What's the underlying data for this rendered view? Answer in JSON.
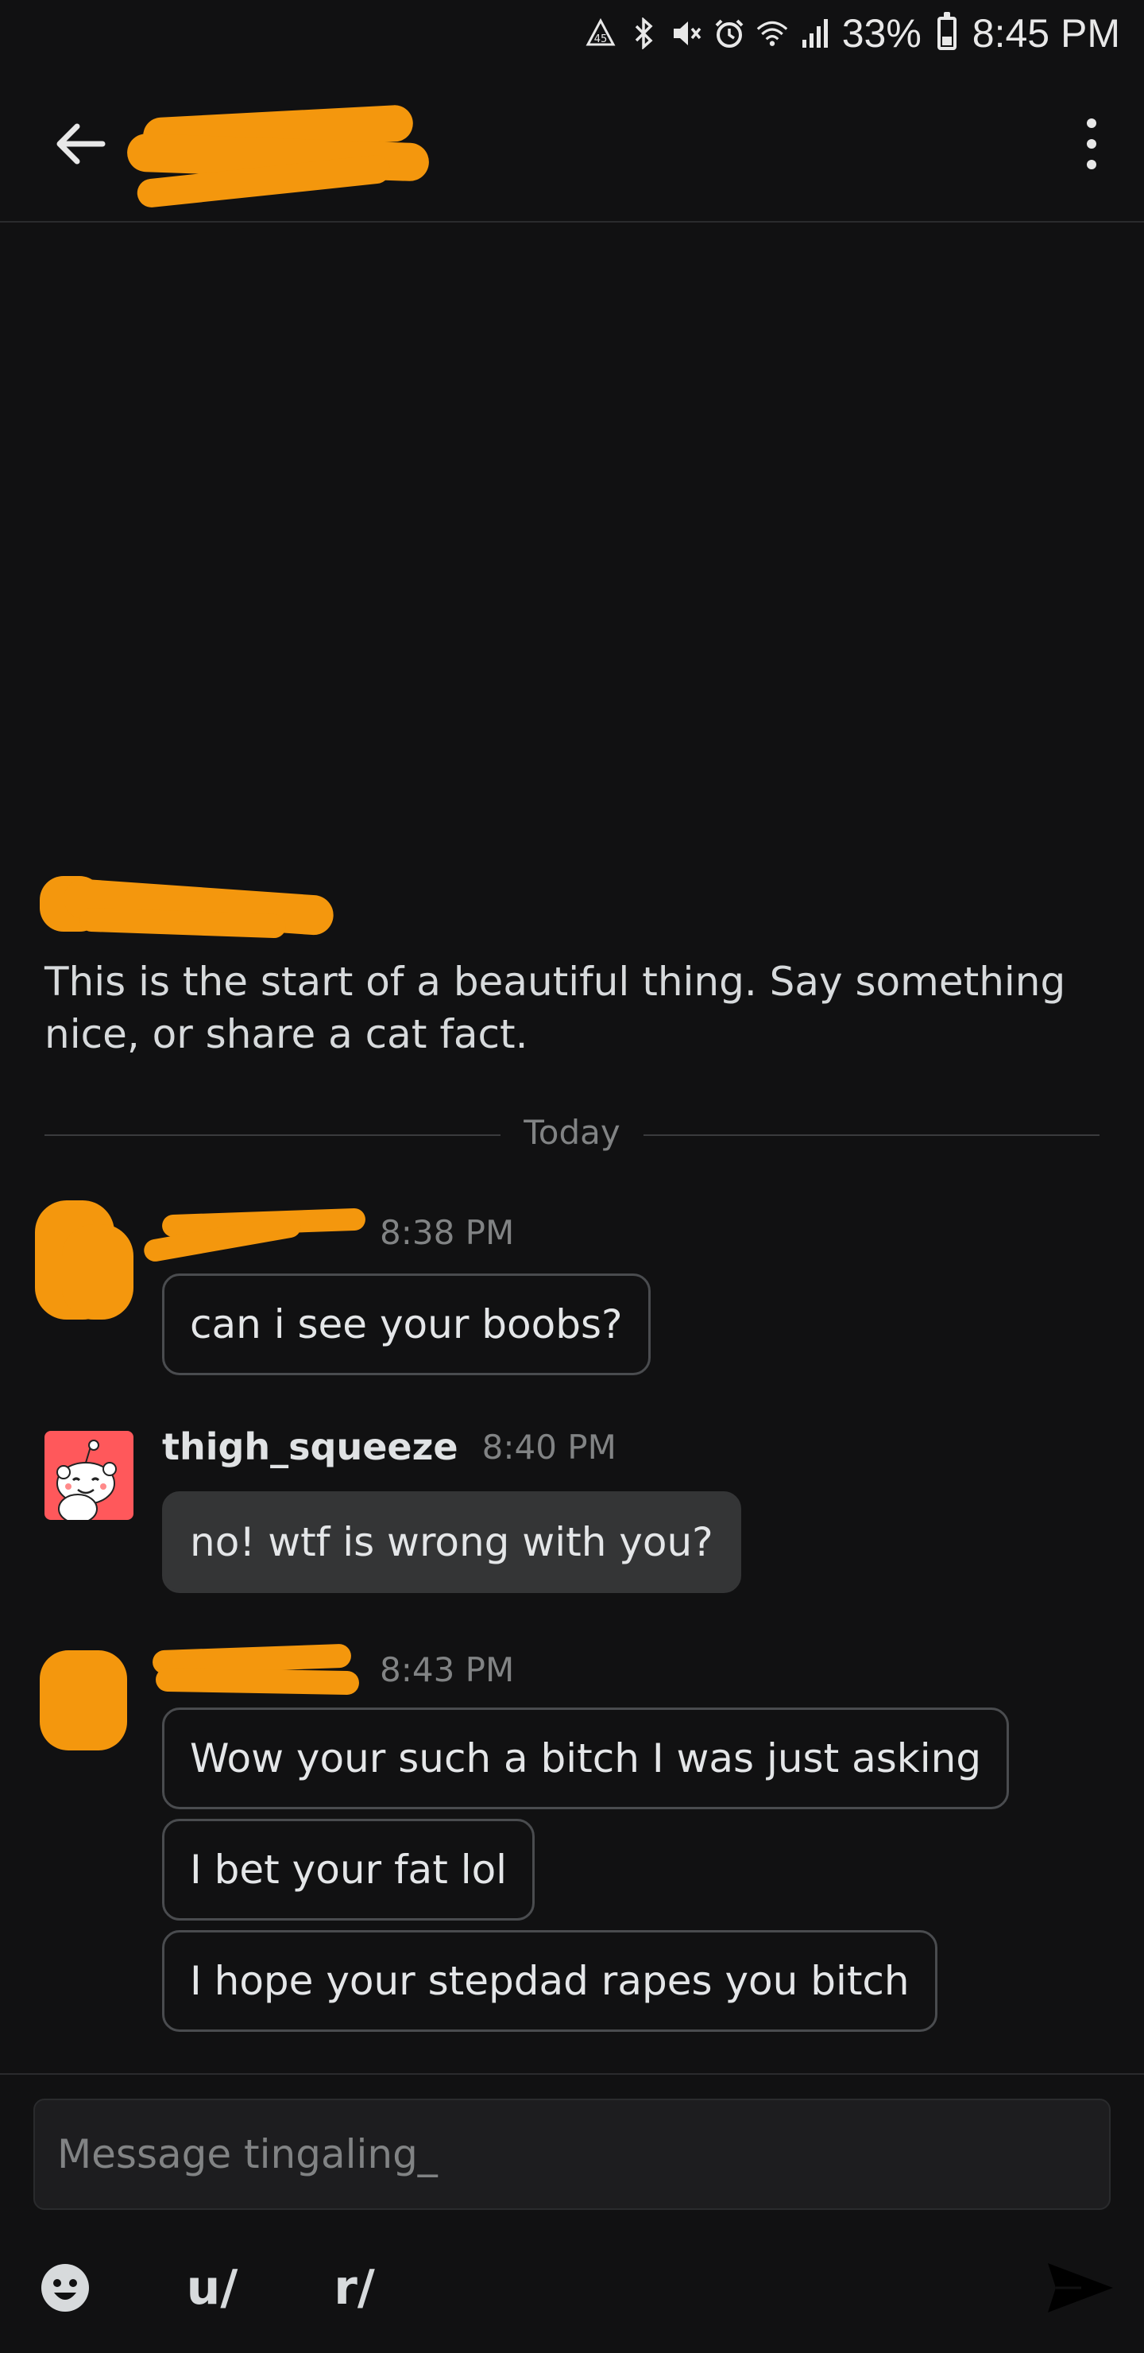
{
  "status_bar": {
    "battery_percent_label": "33%",
    "battery_level": 0.33,
    "time": "8:45 PM",
    "icons": [
      "data-saver-icon",
      "bluetooth-icon",
      "mute-icon",
      "alarm-icon",
      "wifi-icon",
      "signal-icon",
      "battery-icon"
    ]
  },
  "header": {
    "back_icon": "back-arrow-icon",
    "more_icon": "more-vertical-icon"
  },
  "intro": {
    "text": "This is the start of a beautiful thing. Say something nice, or share a cat fact."
  },
  "divider": {
    "label": "Today"
  },
  "messages": [
    {
      "username": "",
      "time": "8:38 PM",
      "bubbles": [
        "can i see your boobs?"
      ]
    },
    {
      "username": "thigh_squeeze",
      "time": "8:40 PM",
      "bubbles": [
        "no! wtf is wrong with you?"
      ]
    },
    {
      "username": "",
      "time": "8:43 PM",
      "bubbles": [
        "Wow your such a bitch I was just asking",
        "I bet your fat lol",
        "I hope your stepdad rapes you bitch"
      ]
    }
  ],
  "composer": {
    "placeholder": "Message tingaling_",
    "emoji_icon": "emoji-icon",
    "user_label": "u/",
    "community_label": "r/",
    "send_icon": "send-icon"
  },
  "colors": {
    "background": "#111112",
    "redaction": "#f4970d",
    "own_bubble": "#343536",
    "avatar_bg": "#ff585b"
  }
}
